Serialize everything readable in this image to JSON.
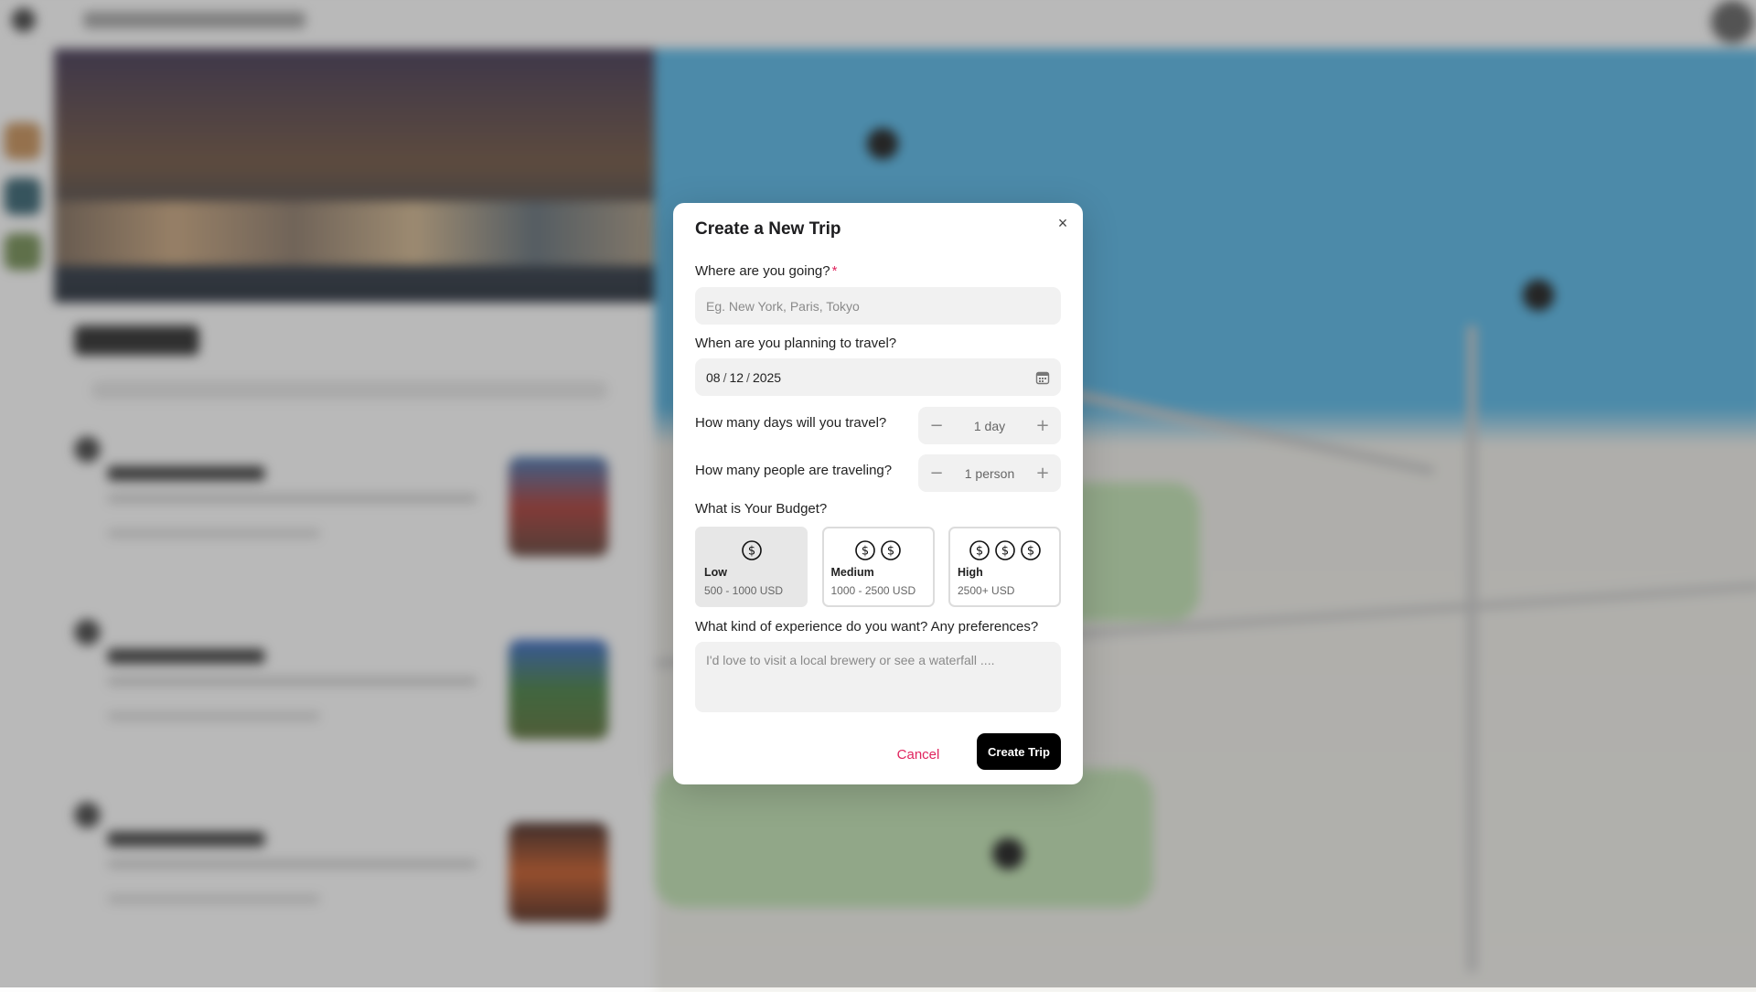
{
  "modal": {
    "title": "Create a New Trip",
    "destination": {
      "label": "Where are you going?",
      "required_mark": "*",
      "placeholder": "Eg. New York, Paris, Tokyo",
      "value": ""
    },
    "date": {
      "label": "When are you planning to travel?",
      "month": "08",
      "day": "12",
      "year": "2025",
      "separator": "/"
    },
    "days": {
      "label": "How many days will you travel?",
      "value_text": "1 day",
      "decrement": "−",
      "increment": "+"
    },
    "people": {
      "label": "How many people are traveling?",
      "value_text": "1 person",
      "decrement": "−",
      "increment": "+"
    },
    "budget": {
      "label": "What is Your Budget?",
      "selected": "Low",
      "options": [
        {
          "name": "Low",
          "range": "500 - 1000 USD",
          "coins": 1
        },
        {
          "name": "Medium",
          "range": "1000 - 2500 USD",
          "coins": 2
        },
        {
          "name": "High",
          "range": "2500+ USD",
          "coins": 3
        }
      ]
    },
    "preferences": {
      "label": "What kind of experience do you want? Any preferences?",
      "placeholder": "I'd love to visit a local brewery or see a waterfall ...."
    },
    "cancel_label": "Cancel",
    "create_label": "Create Trip",
    "close_glyph": "×"
  },
  "colors": {
    "accent_pink": "#e0245e",
    "primary_button": "#000000",
    "field_bg": "#f1f1f1",
    "selected_card_bg": "#e7e7e7"
  },
  "icons": [
    "close-icon",
    "calendar-icon",
    "minus-icon",
    "plus-icon",
    "dollar-coin-icon"
  ]
}
